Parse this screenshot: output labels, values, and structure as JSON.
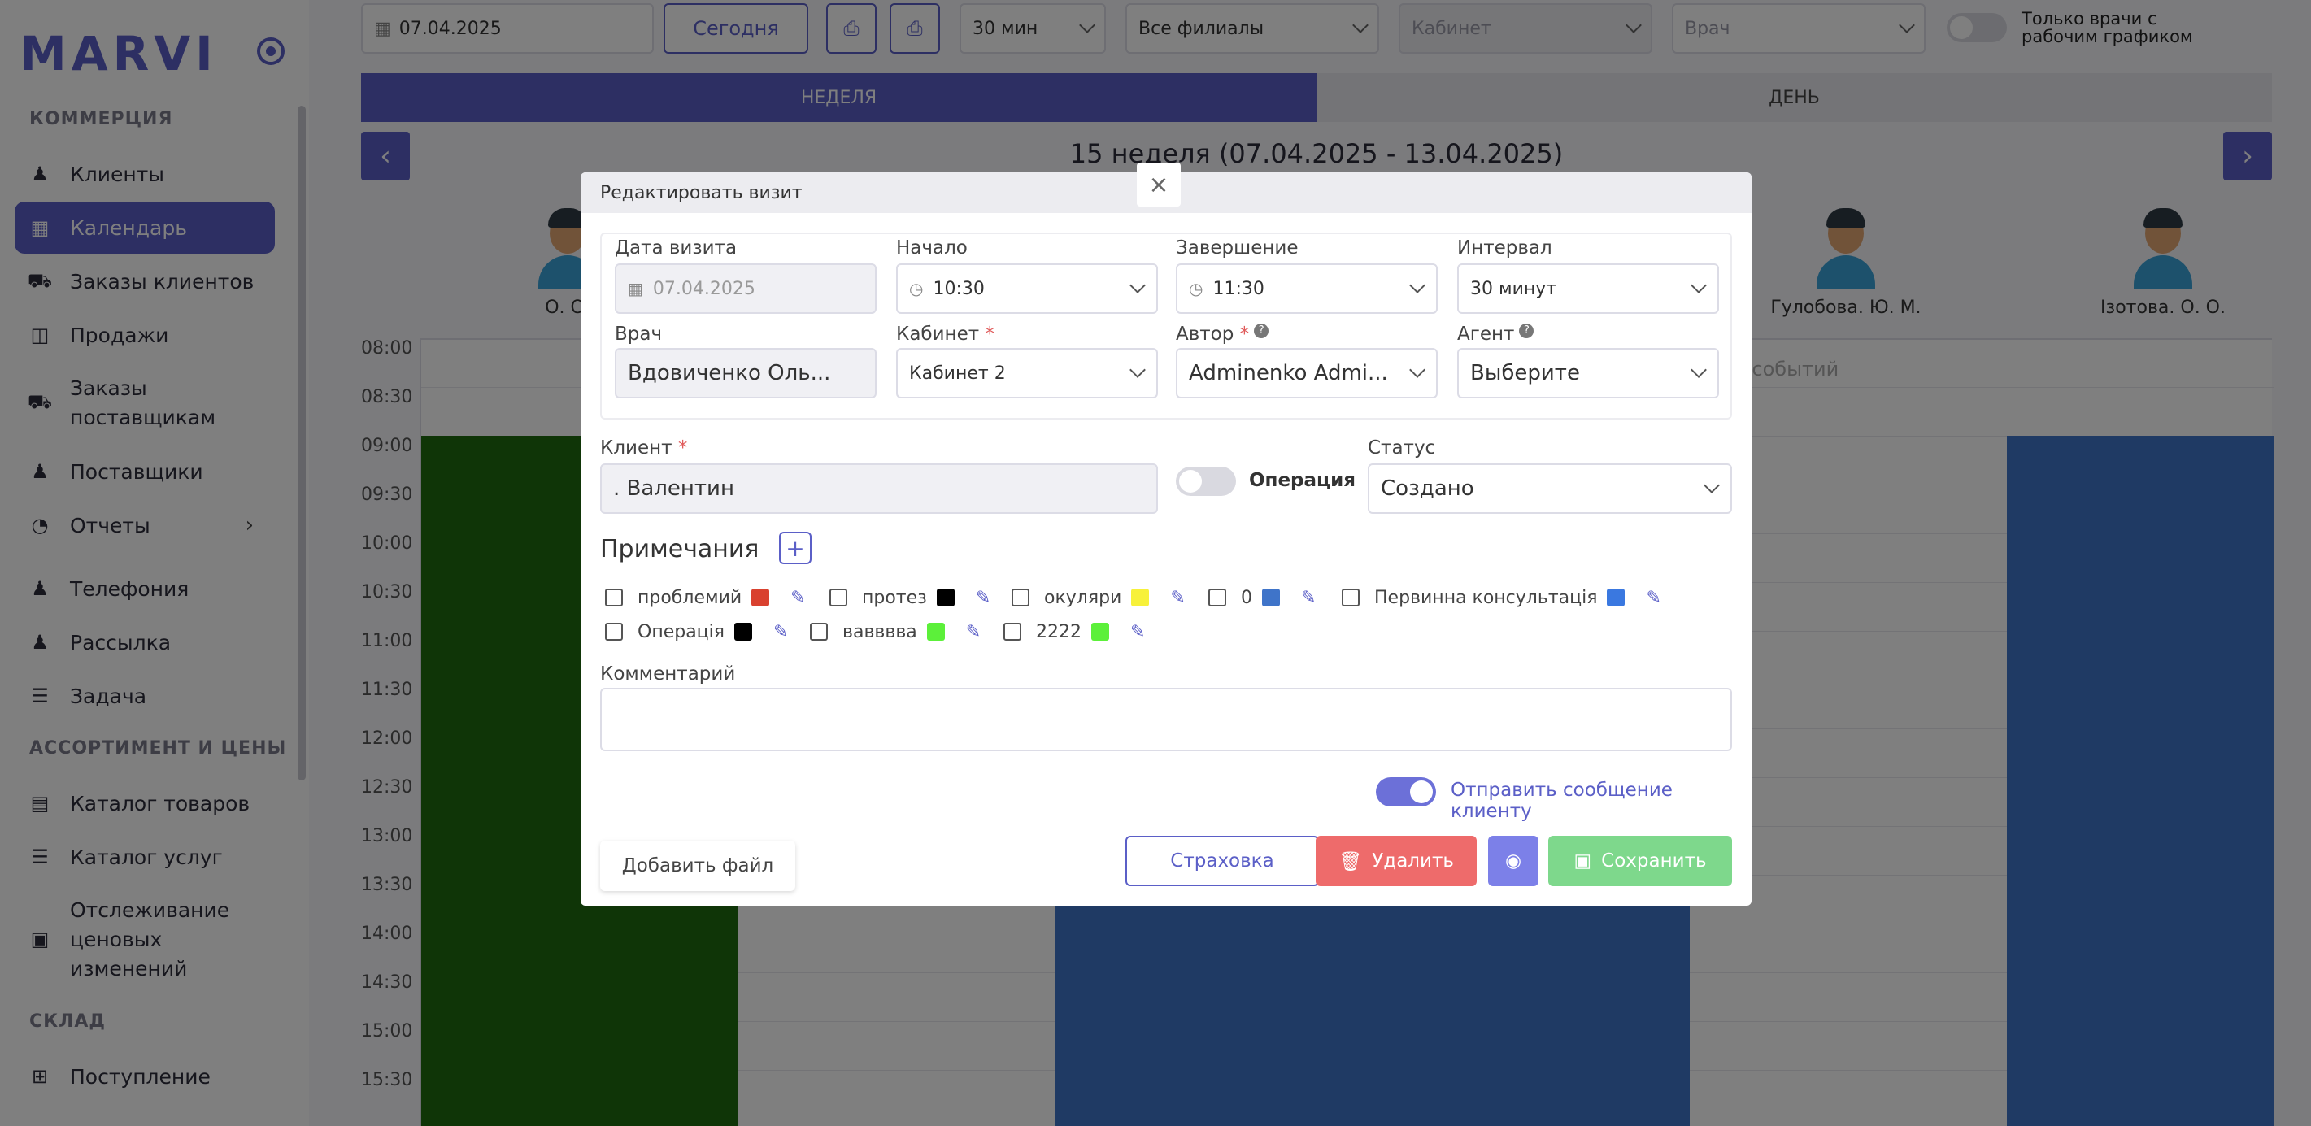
{
  "sidebar": {
    "logo": "MARVI",
    "sections": {
      "commerce": "КОММЕРЦИЯ",
      "assortment": "АССОРТИМЕНТ И ЦЕНЫ",
      "warehouse": "СКЛАД"
    },
    "items": [
      {
        "label": "Клиенты",
        "icon": "users-icon"
      },
      {
        "label": "Календарь",
        "icon": "calendar-icon"
      },
      {
        "label": "Заказы клиентов",
        "icon": "truck-icon"
      },
      {
        "label": "Продажи",
        "icon": "basket-icon"
      },
      {
        "label": "Заказы поставщикам",
        "icon": "truck-icon"
      },
      {
        "label": "Поставщики",
        "icon": "user-icon"
      },
      {
        "label": "Отчеты",
        "icon": "pie-chart-icon"
      },
      {
        "label": "Телефония",
        "icon": "user-icon"
      },
      {
        "label": "Рассылка",
        "icon": "user-icon"
      },
      {
        "label": "Задача",
        "icon": "list-icon"
      },
      {
        "label": "Каталог товаров",
        "icon": "catalog-icon"
      },
      {
        "label": "Каталог услуг",
        "icon": "list-icon"
      },
      {
        "label": "Отслеживание ценовых изменений",
        "icon": "money-icon"
      },
      {
        "label": "Поступление",
        "icon": "plus-folder-icon"
      }
    ]
  },
  "toolbar": {
    "date": "07.04.2025",
    "today": "Сегодня",
    "interval": "30 мин",
    "branches": "Все филиалы",
    "cabinet_placeholder": "Кабинет",
    "doctor_placeholder": "Врач",
    "only_doctors": "Только врачи с рабочим графиком"
  },
  "view_tabs": {
    "week": "НЕДЕЛЯ",
    "day": "ДЕНЬ"
  },
  "week_title": "15 неделя (07.04.2025 - 13.04.2025)",
  "calendar": {
    "times": [
      "08:00",
      "08:30",
      "09:00",
      "09:30",
      "10:00",
      "10:30",
      "11:00",
      "11:30",
      "12:00",
      "12:30",
      "13:00",
      "13:30",
      "14:00",
      "14:30",
      "15:00",
      "15:30"
    ],
    "doctors": [
      "О. О.",
      "Гулобова. Ю. М.",
      "Ізотова. О. О."
    ],
    "no_events": "Нет событий",
    "colors": {
      "green": "#1f6b0e",
      "blue": "#3f74c9"
    }
  },
  "modal": {
    "title": "Редактировать визит",
    "close": "×",
    "visit_date": {
      "label": "Дата визита",
      "value": "07.04.2025"
    },
    "start": {
      "label": "Начало",
      "value": "10:30"
    },
    "end": {
      "label": "Завершение",
      "value": "11:30"
    },
    "interval": {
      "label": "Интервал",
      "value": "30 минут"
    },
    "doctor": {
      "label": "Врач",
      "value": "Вдовиченко Оль..."
    },
    "cabinet": {
      "label": "Кабинет",
      "value": "Кабинет 2"
    },
    "author": {
      "label": "Автор",
      "value": "Adminenko Admi..."
    },
    "agent": {
      "label": "Агент",
      "value": "Выберите"
    },
    "client": {
      "label": "Клиент",
      "value": ". Валентин"
    },
    "operation_label": "Операция",
    "status": {
      "label": "Статус",
      "value": "Создано"
    },
    "notes_title": "Примечания",
    "notes": [
      {
        "label": "проблемий",
        "color": "#d9412f"
      },
      {
        "label": "протез",
        "color": "#000000"
      },
      {
        "label": "окуляри",
        "color": "#f7f13a"
      },
      {
        "label": "0",
        "color": "#3f74c9"
      },
      {
        "label": "Первинна консультація",
        "color": "#3a78e0"
      },
      {
        "label": "Операція",
        "color": "#000000"
      },
      {
        "label": "вавввва",
        "color": "#5cf03a"
      },
      {
        "label": "2222",
        "color": "#5cf03a"
      }
    ],
    "comment_label": "Комментарий",
    "send_message": "Отправить сообщение клиенту",
    "buttons": {
      "add_file": "Добавить файл",
      "insurance": "Страховка",
      "delete": "Удалить",
      "save": "Сохранить"
    }
  }
}
